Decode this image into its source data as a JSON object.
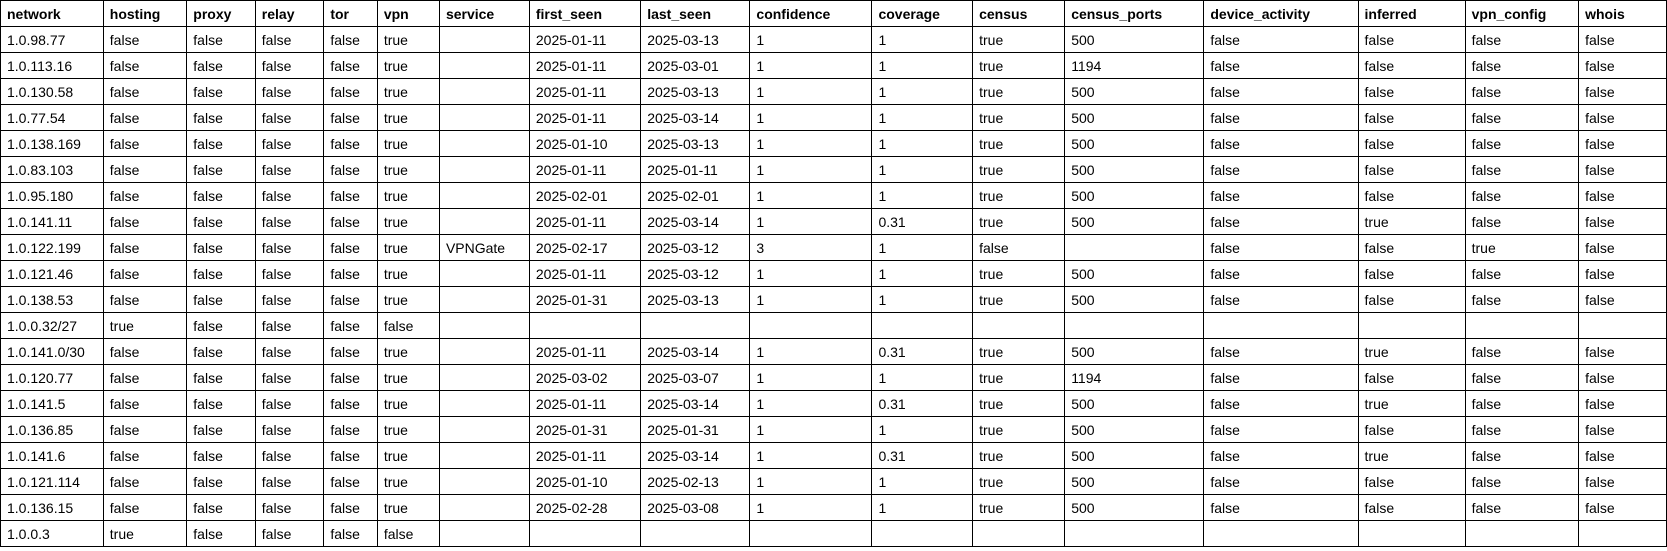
{
  "columns": [
    {
      "key": "network",
      "label": "network"
    },
    {
      "key": "hosting",
      "label": "hosting"
    },
    {
      "key": "proxy",
      "label": "proxy"
    },
    {
      "key": "relay",
      "label": "relay"
    },
    {
      "key": "tor",
      "label": "tor"
    },
    {
      "key": "vpn",
      "label": "vpn"
    },
    {
      "key": "service",
      "label": "service"
    },
    {
      "key": "first_seen",
      "label": "first_seen"
    },
    {
      "key": "last_seen",
      "label": "last_seen"
    },
    {
      "key": "confidence",
      "label": "confidence"
    },
    {
      "key": "coverage",
      "label": "coverage"
    },
    {
      "key": "census",
      "label": "census"
    },
    {
      "key": "census_ports",
      "label": "census_ports"
    },
    {
      "key": "device_activity",
      "label": "device_activity"
    },
    {
      "key": "inferred",
      "label": "inferred"
    },
    {
      "key": "vpn_config",
      "label": "vpn_config"
    },
    {
      "key": "whois",
      "label": "whois"
    }
  ],
  "rows": [
    {
      "network": "1.0.98.77",
      "hosting": "false",
      "proxy": "false",
      "relay": "false",
      "tor": "false",
      "vpn": "true",
      "service": "",
      "first_seen": "2025-01-11",
      "last_seen": "2025-03-13",
      "confidence": "1",
      "coverage": "1",
      "census": "true",
      "census_ports": "500",
      "device_activity": "false",
      "inferred": "false",
      "vpn_config": "false",
      "whois": "false"
    },
    {
      "network": "1.0.113.16",
      "hosting": "false",
      "proxy": "false",
      "relay": "false",
      "tor": "false",
      "vpn": "true",
      "service": "",
      "first_seen": "2025-01-11",
      "last_seen": "2025-03-01",
      "confidence": "1",
      "coverage": "1",
      "census": "true",
      "census_ports": "1194",
      "device_activity": "false",
      "inferred": "false",
      "vpn_config": "false",
      "whois": "false"
    },
    {
      "network": "1.0.130.58",
      "hosting": "false",
      "proxy": "false",
      "relay": "false",
      "tor": "false",
      "vpn": "true",
      "service": "",
      "first_seen": "2025-01-11",
      "last_seen": "2025-03-13",
      "confidence": "1",
      "coverage": "1",
      "census": "true",
      "census_ports": "500",
      "device_activity": "false",
      "inferred": "false",
      "vpn_config": "false",
      "whois": "false"
    },
    {
      "network": "1.0.77.54",
      "hosting": "false",
      "proxy": "false",
      "relay": "false",
      "tor": "false",
      "vpn": "true",
      "service": "",
      "first_seen": "2025-01-11",
      "last_seen": "2025-03-14",
      "confidence": "1",
      "coverage": "1",
      "census": "true",
      "census_ports": "500",
      "device_activity": "false",
      "inferred": "false",
      "vpn_config": "false",
      "whois": "false"
    },
    {
      "network": "1.0.138.169",
      "hosting": "false",
      "proxy": "false",
      "relay": "false",
      "tor": "false",
      "vpn": "true",
      "service": "",
      "first_seen": "2025-01-10",
      "last_seen": "2025-03-13",
      "confidence": "1",
      "coverage": "1",
      "census": "true",
      "census_ports": "500",
      "device_activity": "false",
      "inferred": "false",
      "vpn_config": "false",
      "whois": "false"
    },
    {
      "network": "1.0.83.103",
      "hosting": "false",
      "proxy": "false",
      "relay": "false",
      "tor": "false",
      "vpn": "true",
      "service": "",
      "first_seen": "2025-01-11",
      "last_seen": "2025-01-11",
      "confidence": "1",
      "coverage": "1",
      "census": "true",
      "census_ports": "500",
      "device_activity": "false",
      "inferred": "false",
      "vpn_config": "false",
      "whois": "false"
    },
    {
      "network": "1.0.95.180",
      "hosting": "false",
      "proxy": "false",
      "relay": "false",
      "tor": "false",
      "vpn": "true",
      "service": "",
      "first_seen": "2025-02-01",
      "last_seen": "2025-02-01",
      "confidence": "1",
      "coverage": "1",
      "census": "true",
      "census_ports": "500",
      "device_activity": "false",
      "inferred": "false",
      "vpn_config": "false",
      "whois": "false"
    },
    {
      "network": "1.0.141.11",
      "hosting": "false",
      "proxy": "false",
      "relay": "false",
      "tor": "false",
      "vpn": "true",
      "service": "",
      "first_seen": "2025-01-11",
      "last_seen": "2025-03-14",
      "confidence": "1",
      "coverage": "0.31",
      "census": "true",
      "census_ports": "500",
      "device_activity": "false",
      "inferred": "true",
      "vpn_config": "false",
      "whois": "false"
    },
    {
      "network": "1.0.122.199",
      "hosting": "false",
      "proxy": "false",
      "relay": "false",
      "tor": "false",
      "vpn": "true",
      "service": "VPNGate",
      "first_seen": "2025-02-17",
      "last_seen": "2025-03-12",
      "confidence": "3",
      "coverage": "1",
      "census": "false",
      "census_ports": "",
      "device_activity": "false",
      "inferred": "false",
      "vpn_config": "true",
      "whois": "false"
    },
    {
      "network": "1.0.121.46",
      "hosting": "false",
      "proxy": "false",
      "relay": "false",
      "tor": "false",
      "vpn": "true",
      "service": "",
      "first_seen": "2025-01-11",
      "last_seen": "2025-03-12",
      "confidence": "1",
      "coverage": "1",
      "census": "true",
      "census_ports": "500",
      "device_activity": "false",
      "inferred": "false",
      "vpn_config": "false",
      "whois": "false"
    },
    {
      "network": "1.0.138.53",
      "hosting": "false",
      "proxy": "false",
      "relay": "false",
      "tor": "false",
      "vpn": "true",
      "service": "",
      "first_seen": "2025-01-31",
      "last_seen": "2025-03-13",
      "confidence": "1",
      "coverage": "1",
      "census": "true",
      "census_ports": "500",
      "device_activity": "false",
      "inferred": "false",
      "vpn_config": "false",
      "whois": "false"
    },
    {
      "network": "1.0.0.32/27",
      "hosting": "true",
      "proxy": "false",
      "relay": "false",
      "tor": "false",
      "vpn": "false",
      "service": "",
      "first_seen": "",
      "last_seen": "",
      "confidence": "",
      "coverage": "",
      "census": "",
      "census_ports": "",
      "device_activity": "",
      "inferred": "",
      "vpn_config": "",
      "whois": ""
    },
    {
      "network": "1.0.141.0/30",
      "hosting": "false",
      "proxy": "false",
      "relay": "false",
      "tor": "false",
      "vpn": "true",
      "service": "",
      "first_seen": "2025-01-11",
      "last_seen": "2025-03-14",
      "confidence": "1",
      "coverage": "0.31",
      "census": "true",
      "census_ports": "500",
      "device_activity": "false",
      "inferred": "true",
      "vpn_config": "false",
      "whois": "false"
    },
    {
      "network": "1.0.120.77",
      "hosting": "false",
      "proxy": "false",
      "relay": "false",
      "tor": "false",
      "vpn": "true",
      "service": "",
      "first_seen": "2025-03-02",
      "last_seen": "2025-03-07",
      "confidence": "1",
      "coverage": "1",
      "census": "true",
      "census_ports": "1194",
      "device_activity": "false",
      "inferred": "false",
      "vpn_config": "false",
      "whois": "false"
    },
    {
      "network": "1.0.141.5",
      "hosting": "false",
      "proxy": "false",
      "relay": "false",
      "tor": "false",
      "vpn": "true",
      "service": "",
      "first_seen": "2025-01-11",
      "last_seen": "2025-03-14",
      "confidence": "1",
      "coverage": "0.31",
      "census": "true",
      "census_ports": "500",
      "device_activity": "false",
      "inferred": "true",
      "vpn_config": "false",
      "whois": "false"
    },
    {
      "network": "1.0.136.85",
      "hosting": "false",
      "proxy": "false",
      "relay": "false",
      "tor": "false",
      "vpn": "true",
      "service": "",
      "first_seen": "2025-01-31",
      "last_seen": "2025-01-31",
      "confidence": "1",
      "coverage": "1",
      "census": "true",
      "census_ports": "500",
      "device_activity": "false",
      "inferred": "false",
      "vpn_config": "false",
      "whois": "false"
    },
    {
      "network": "1.0.141.6",
      "hosting": "false",
      "proxy": "false",
      "relay": "false",
      "tor": "false",
      "vpn": "true",
      "service": "",
      "first_seen": "2025-01-11",
      "last_seen": "2025-03-14",
      "confidence": "1",
      "coverage": "0.31",
      "census": "true",
      "census_ports": "500",
      "device_activity": "false",
      "inferred": "true",
      "vpn_config": "false",
      "whois": "false"
    },
    {
      "network": "1.0.121.114",
      "hosting": "false",
      "proxy": "false",
      "relay": "false",
      "tor": "false",
      "vpn": "true",
      "service": "",
      "first_seen": "2025-01-10",
      "last_seen": "2025-02-13",
      "confidence": "1",
      "coverage": "1",
      "census": "true",
      "census_ports": "500",
      "device_activity": "false",
      "inferred": "false",
      "vpn_config": "false",
      "whois": "false"
    },
    {
      "network": "1.0.136.15",
      "hosting": "false",
      "proxy": "false",
      "relay": "false",
      "tor": "false",
      "vpn": "true",
      "service": "",
      "first_seen": "2025-02-28",
      "last_seen": "2025-03-08",
      "confidence": "1",
      "coverage": "1",
      "census": "true",
      "census_ports": "500",
      "device_activity": "false",
      "inferred": "false",
      "vpn_config": "false",
      "whois": "false"
    },
    {
      "network": "1.0.0.3",
      "hosting": "true",
      "proxy": "false",
      "relay": "false",
      "tor": "false",
      "vpn": "false",
      "service": "",
      "first_seen": "",
      "last_seen": "",
      "confidence": "",
      "coverage": "",
      "census": "",
      "census_ports": "",
      "device_activity": "",
      "inferred": "",
      "vpn_config": "",
      "whois": ""
    }
  ]
}
